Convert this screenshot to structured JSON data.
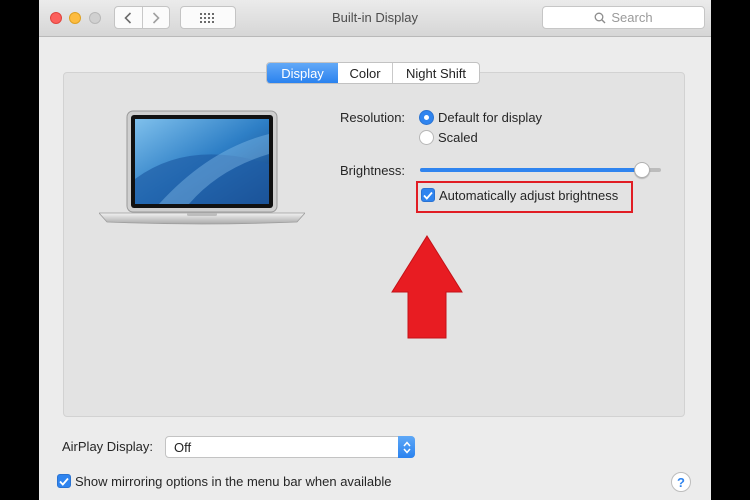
{
  "window": {
    "title": "Built-in Display",
    "search_placeholder": "Search"
  },
  "tabs": [
    {
      "label": "Display",
      "selected": true
    },
    {
      "label": "Color",
      "selected": false
    },
    {
      "label": "Night Shift",
      "selected": false
    }
  ],
  "resolution": {
    "label": "Resolution:",
    "options": [
      {
        "label": "Default for display",
        "selected": true
      },
      {
        "label": "Scaled",
        "selected": false
      }
    ]
  },
  "brightness": {
    "label": "Brightness:",
    "level_percent": 92
  },
  "auto_brightness": {
    "label": "Automatically adjust brightness",
    "checked": true
  },
  "airplay": {
    "label": "AirPlay Display:",
    "value": "Off"
  },
  "mirroring": {
    "label": "Show mirroring options in the menu bar when available",
    "checked": true
  },
  "help": {
    "symbol": "?"
  },
  "colors": {
    "accent": "#2f84ef",
    "annotation_red": "#e11d24"
  }
}
